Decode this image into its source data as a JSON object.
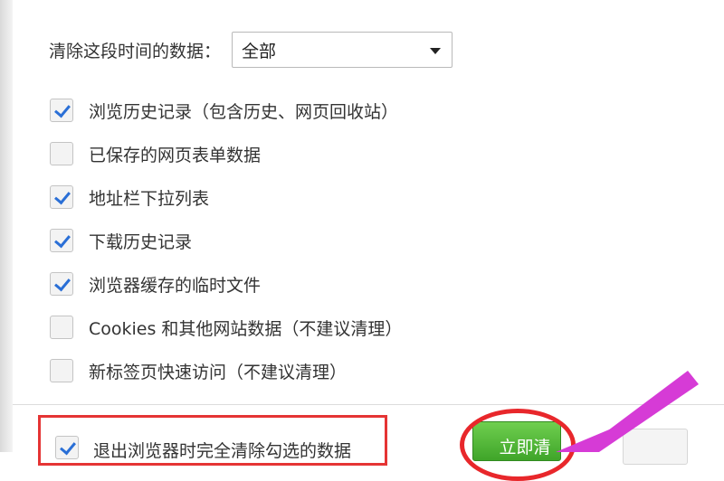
{
  "range": {
    "label": "清除这段时间的数据：",
    "selected": "全部"
  },
  "options": [
    {
      "label": "浏览历史记录（包含历史、网页回收站）",
      "checked": true
    },
    {
      "label": "已保存的网页表单数据",
      "checked": false
    },
    {
      "label": "地址栏下拉列表",
      "checked": true
    },
    {
      "label": "下载历史记录",
      "checked": true
    },
    {
      "label": "浏览器缓存的临时文件",
      "checked": true
    },
    {
      "label": "Cookies 和其他网站数据（不建议清理）",
      "checked": false
    },
    {
      "label": "新标签页快速访问（不建议清理）",
      "checked": false
    }
  ],
  "footer": {
    "exit_clear_label": "退出浏览器时完全清除勾选的数据",
    "exit_clear_checked": true,
    "clear_now_label": "立即清"
  },
  "colors": {
    "accent_green": "#4cb733",
    "highlight_red": "#e53434",
    "arrow_magenta": "#d63bd6",
    "check_blue": "#2a6fd6"
  }
}
